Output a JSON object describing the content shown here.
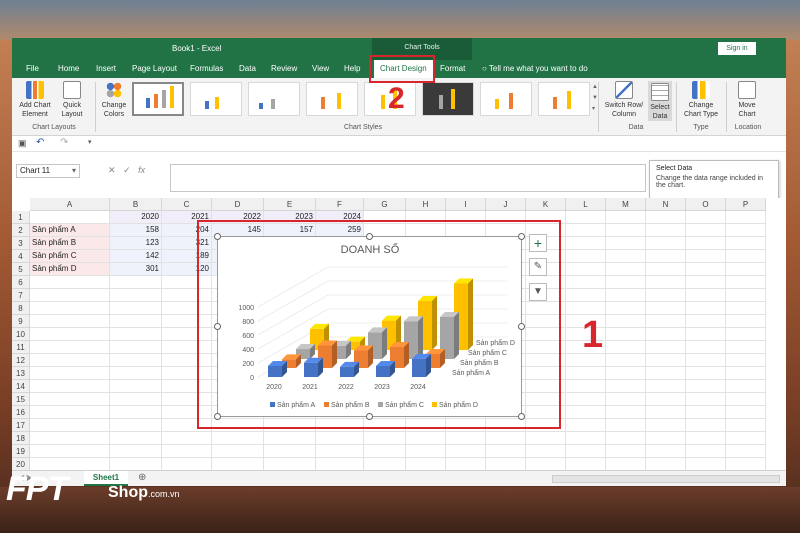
{
  "title_bar": {
    "document": "Book1  -  Excel",
    "context_group": "Chart Tools",
    "sign_in": "Sign in"
  },
  "tabs": [
    "File",
    "Home",
    "Insert",
    "Page Layout",
    "Formulas",
    "Data",
    "Review",
    "View",
    "Help",
    "Chart Design",
    "Format"
  ],
  "tell_me": "Tell me what you want to do",
  "ribbon": {
    "add_chart_element": "Add Chart Element",
    "quick_layout": "Quick Layout",
    "chart_layouts_group": "Chart Layouts",
    "change_colors": "Change Colors",
    "chart_styles_group": "Chart Styles",
    "switch_row_column": "Switch Row/ Column",
    "select_data": "Select Data",
    "data_group": "Data",
    "change_chart_type": "Change Chart Type",
    "type_group": "Type",
    "move_chart": "Move Chart",
    "location_group": "Location"
  },
  "name_box": "Chart 11",
  "tooltip": {
    "title": "Select Data",
    "body": "Change the data range included in the chart."
  },
  "columns": [
    "A",
    "B",
    "C",
    "D",
    "E",
    "F",
    "G",
    "H",
    "I",
    "J",
    "K",
    "L",
    "M",
    "N",
    "O",
    "P"
  ],
  "rows": [
    "1",
    "2",
    "3",
    "4",
    "5",
    "6",
    "7",
    "8",
    "9",
    "10",
    "11",
    "12",
    "13",
    "14",
    "15",
    "16",
    "17",
    "18",
    "19",
    "20"
  ],
  "sheet": {
    "header_row": [
      "",
      "2020",
      "2021",
      "2022",
      "2023",
      "2024"
    ],
    "data_rows": [
      [
        "Sản phẩm A",
        "158",
        "204",
        "145",
        "157",
        "259"
      ],
      [
        "Sản phẩm B",
        "123",
        "321",
        "",
        "",
        ""
      ],
      [
        "Sản phẩm C",
        "142",
        "189",
        "",
        "",
        ""
      ],
      [
        "Sản phẩm D",
        "301",
        "120",
        "",
        "",
        ""
      ]
    ]
  },
  "sheet_tab": "Sheet1",
  "annotations": {
    "one": "1",
    "two": "2"
  },
  "brand": {
    "fpt": "FPT",
    "shop": "Shop",
    "domain": ".com.vn"
  },
  "colors": {
    "excel_green": "#217346",
    "series_a": "#4472C4",
    "series_b": "#ED7D31",
    "series_c": "#A5A5A5",
    "series_d": "#FFC000",
    "annotation_red": "#d7262c"
  },
  "chart_data": {
    "type": "bar",
    "title": "DOANH SỐ",
    "categories": [
      "2020",
      "2021",
      "2022",
      "2023",
      "2024"
    ],
    "series": [
      {
        "name": "Sản phẩm A",
        "values": [
          158,
          204,
          145,
          157,
          259
        ]
      },
      {
        "name": "Sản phẩm B",
        "values": [
          123,
          321,
          250,
          300,
          200
        ]
      },
      {
        "name": "Sản phẩm C",
        "values": [
          142,
          189,
          380,
          540,
          600
        ]
      },
      {
        "name": "Sản phẩm D",
        "values": [
          301,
          120,
          420,
          700,
          950
        ]
      }
    ],
    "yticks": [
      "0",
      "200",
      "400",
      "600",
      "800",
      "1000"
    ],
    "ylim": [
      0,
      1000
    ],
    "legend": "bottom",
    "depth_labels": [
      "Sản phẩm D",
      "Sản phẩm C",
      "Sản phẩm B",
      "Sản phẩm A"
    ]
  }
}
